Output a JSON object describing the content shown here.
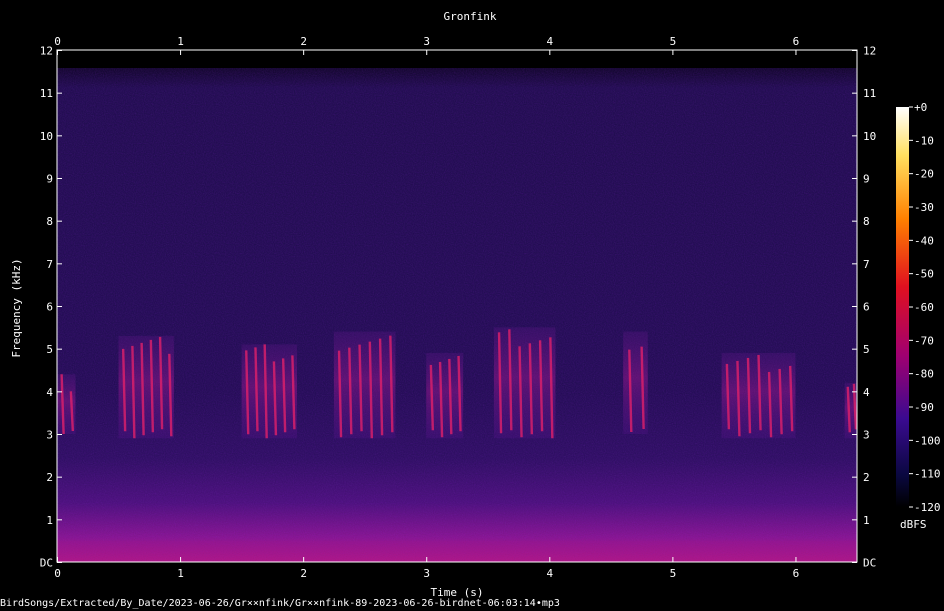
{
  "chart_data": {
    "type": "heatmap",
    "title": "Gronfink",
    "xlabel": "Time (s)",
    "ylabel": "Frequency (kHz)",
    "xlim": [
      0,
      6.5
    ],
    "ylim": [
      0,
      12
    ],
    "x_ticks": [
      0,
      1,
      2,
      3,
      4,
      5,
      6
    ],
    "x_tick_labels": [
      "0",
      "1",
      "2",
      "3",
      "4",
      "5",
      "6"
    ],
    "y_ticks": [
      0,
      1,
      2,
      3,
      4,
      5,
      6,
      7,
      8,
      9,
      10,
      11,
      12
    ],
    "y_tick_labels": [
      "DC",
      "1",
      "2",
      "3",
      "4",
      "5",
      "6",
      "7",
      "8",
      "9",
      "10",
      "11",
      "12"
    ],
    "colorbar": {
      "label": "dBFS",
      "range": [
        -120,
        0
      ],
      "ticks": [
        0,
        -10,
        -20,
        -30,
        -40,
        -50,
        -60,
        -70,
        -80,
        -90,
        -100,
        -110,
        -120
      ],
      "tick_labels": [
        "+0",
        "-10",
        "-20",
        "-30",
        "-40",
        "-50",
        "-60",
        "-70",
        "-80",
        "-90",
        "-100",
        "-110",
        "-120"
      ]
    },
    "call_clusters": [
      {
        "t_start": 0.0,
        "t_end": 0.15,
        "f_low": 3.0,
        "f_high": 4.4
      },
      {
        "t_start": 0.5,
        "t_end": 0.95,
        "f_low": 2.9,
        "f_high": 5.3
      },
      {
        "t_start": 1.5,
        "t_end": 1.95,
        "f_low": 2.9,
        "f_high": 5.1
      },
      {
        "t_start": 2.25,
        "t_end": 2.75,
        "f_low": 2.9,
        "f_high": 5.4
      },
      {
        "t_start": 3.0,
        "t_end": 3.3,
        "f_low": 2.9,
        "f_high": 4.9
      },
      {
        "t_start": 3.55,
        "t_end": 4.05,
        "f_low": 2.9,
        "f_high": 5.5
      },
      {
        "t_start": 4.6,
        "t_end": 4.8,
        "f_low": 3.0,
        "f_high": 5.4
      },
      {
        "t_start": 5.4,
        "t_end": 6.0,
        "f_low": 2.9,
        "f_high": 4.9
      },
      {
        "t_start": 6.4,
        "t_end": 6.5,
        "f_low": 2.9,
        "f_high": 4.2
      }
    ],
    "colors": {
      "background": "#000000",
      "noise": "#1e0a4e",
      "low_band": "#9a1490",
      "peak": "#e0206a"
    }
  },
  "footer_text": "BirdSongs/Extracted/By_Date/2023-06-26/Gr××nfink/Gr××nfink-89-2023-06-26-birdnet-06:03:14•mp3"
}
